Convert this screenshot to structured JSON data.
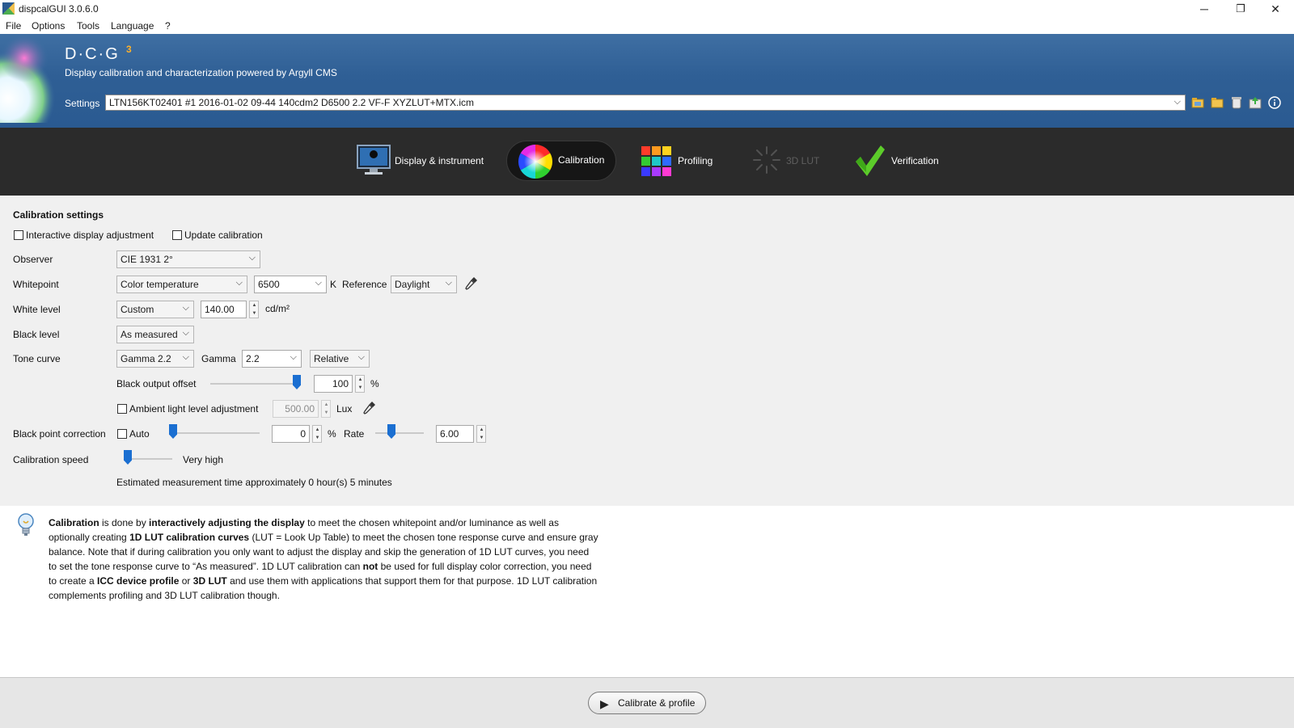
{
  "window": {
    "title": "dispcalGUI 3.0.6.0",
    "minimize_icon": "─",
    "restore_icon": "❐",
    "close_icon": "✕"
  },
  "menubar": [
    "File",
    "Options",
    "Tools",
    "Language",
    "?"
  ],
  "header": {
    "logo_text": "D·C·G",
    "logo_superscript": "3",
    "subtitle": "Display calibration and characterization powered by Argyll CMS",
    "settings_label": "Settings",
    "settings_value": "LTN156KT02401 #1 2016-01-02 09-44 140cdm2 D6500 2.2 VF-F XYZLUT+MTX.icm",
    "icons": [
      "folder-open-icon",
      "folder-icon",
      "delete-icon",
      "install-icon",
      "info-icon"
    ]
  },
  "tabs": [
    {
      "label": "Display & instrument",
      "icon": "monitor-icon",
      "active": false,
      "enabled": true
    },
    {
      "label": "Calibration",
      "icon": "color-wheel-icon",
      "active": true,
      "enabled": true
    },
    {
      "label": "Profiling",
      "icon": "color-grid-icon",
      "active": false,
      "enabled": true
    },
    {
      "label": "3D LUT",
      "icon": "3d-lut-icon",
      "active": false,
      "enabled": false
    },
    {
      "label": "Verification",
      "icon": "checkmark-icon",
      "active": false,
      "enabled": true
    }
  ],
  "calibration": {
    "section_title": "Calibration settings",
    "interactive_adjustment": {
      "label": "Interactive display adjustment",
      "checked": false
    },
    "update_calibration": {
      "label": "Update calibration",
      "checked": false
    },
    "observer": {
      "label": "Observer",
      "value": "CIE 1931 2°"
    },
    "whitepoint": {
      "label": "Whitepoint",
      "mode": "Color temperature",
      "temperature": "6500",
      "unit": "K",
      "reference_label": "Reference",
      "reference": "Daylight"
    },
    "white_level": {
      "label": "White level",
      "mode": "Custom",
      "value": "140.00",
      "unit": "cd/m²"
    },
    "black_level": {
      "label": "Black level",
      "mode": "As measured"
    },
    "tone_curve": {
      "label": "Tone curve",
      "mode": "Gamma 2.2",
      "gamma_label": "Gamma",
      "gamma": "2.2",
      "type": "Relative"
    },
    "black_output_offset": {
      "label": "Black output offset",
      "value": "100",
      "unit": "%",
      "slider_level": 1.0
    },
    "ambient": {
      "label": "Ambient light level adjustment",
      "checked": false,
      "value": "500.00",
      "unit": "Lux"
    },
    "black_point_correction": {
      "label": "Black point correction",
      "auto_label": "Auto",
      "auto_checked": false,
      "value": "0",
      "unit": "%",
      "slider_level": 0.0,
      "rate_label": "Rate",
      "rate": "6.00",
      "rate_slider_level": 0.33
    },
    "speed": {
      "label": "Calibration speed",
      "value": "Very high",
      "slider_level": 0.0
    },
    "estimate": "Estimated measurement time approximately 0 hour(s) 5 minutes"
  },
  "info": {
    "p1_b1": "Calibration",
    "p1_t1": " is done by ",
    "p1_b2": "interactively adjusting the display",
    "p1_t2": " to meet the chosen whitepoint and/or luminance as well as optionally creating ",
    "p1_b3": "1D LUT calibration curves",
    "p1_t3": " (LUT = Look Up Table) to meet the chosen tone response curve and ensure gray balance. Note that if during calibration you only want to adjust the display and skip the generation of 1D LUT curves, you need to set the tone response curve to “As measured”. 1D LUT calibration can ",
    "p1_b4": "not",
    "p1_t4": " be used for full display color correction, you need to create a ",
    "p1_b5": "ICC device profile",
    "p1_t5": " or ",
    "p1_b6": "3D LUT",
    "p1_t6": " and use them with applications that support them for that purpose. 1D LUT calibration complements profiling and 3D LUT calibration though."
  },
  "footer": {
    "button_label": "Calibrate & profile"
  }
}
